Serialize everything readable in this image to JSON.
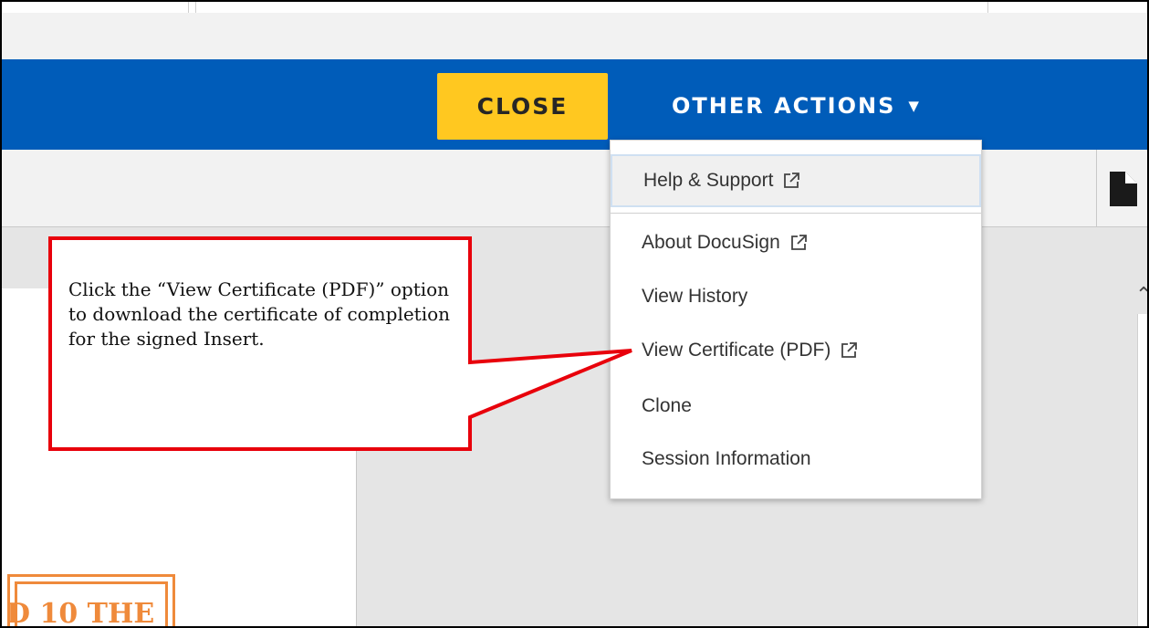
{
  "header": {
    "close_label": "CLOSE",
    "other_actions_label": "OTHER ACTIONS",
    "other_actions_caret": "▼"
  },
  "dropdown": {
    "items": [
      {
        "label": "Help & Support",
        "external": true,
        "icon": "external-link-icon"
      },
      {
        "label": "About DocuSign",
        "external": true,
        "icon": "external-link-icon"
      },
      {
        "label": "View History",
        "external": false
      },
      {
        "label": "View Certificate (PDF)",
        "external": true,
        "icon": "external-link-icon"
      },
      {
        "label": "Clone",
        "external": false
      },
      {
        "label": "Session Information",
        "external": false
      }
    ]
  },
  "document": {
    "stamp_text": "D 10 THE"
  },
  "callout": {
    "text": "Click the “View Certificate (PDF)” option to download the certificate of completion for the signed Insert."
  },
  "colors": {
    "header_blue": "#005cb9",
    "close_yellow": "#ffc820",
    "callout_red": "#e8000b",
    "stamp_orange": "#ef8a3b"
  }
}
